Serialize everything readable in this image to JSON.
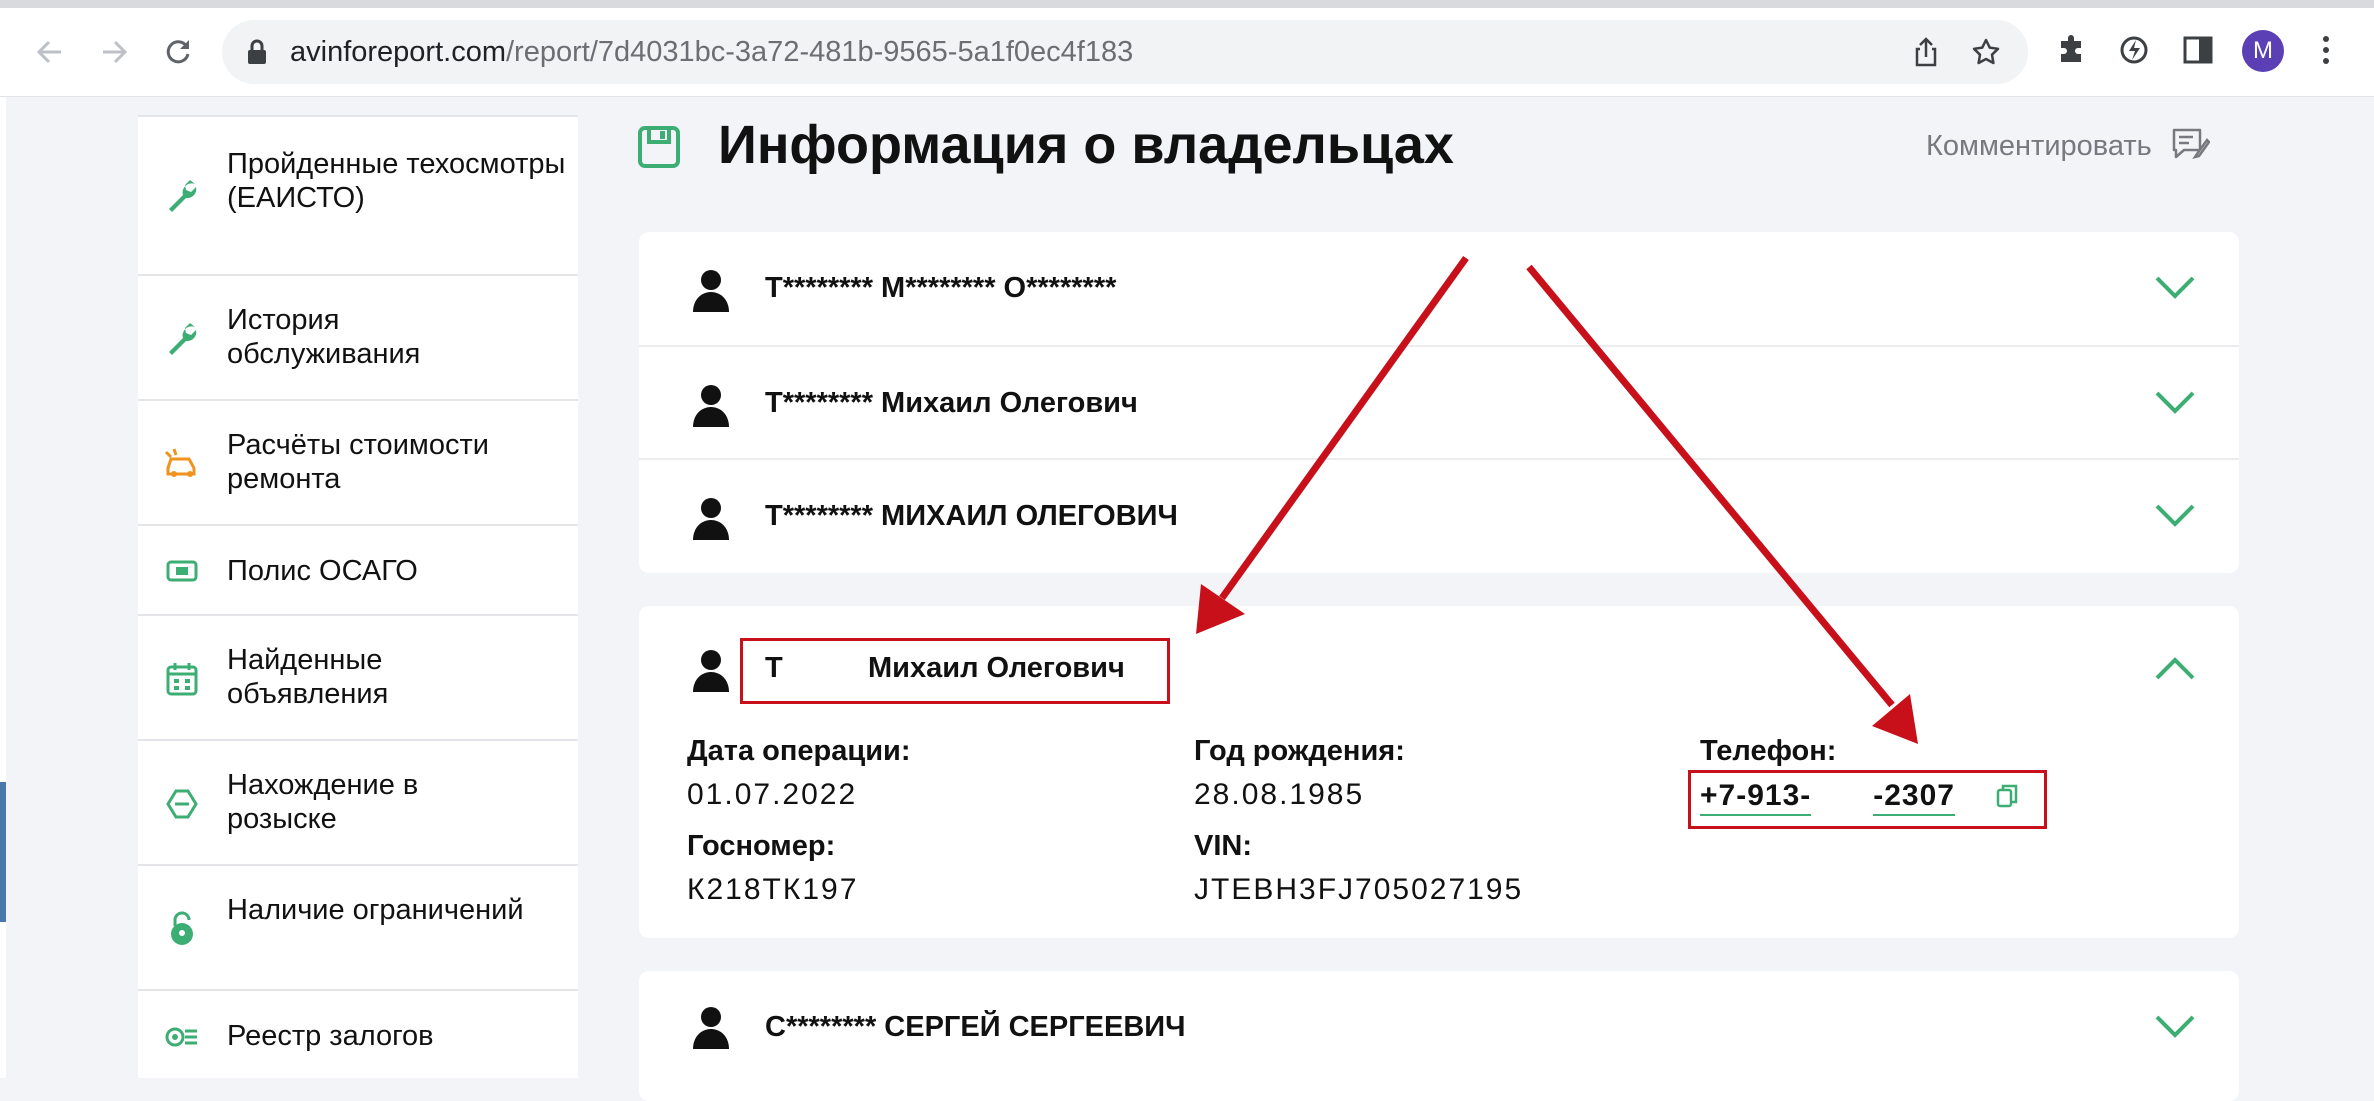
{
  "browser": {
    "url_host": "avinforeport.com",
    "url_path": "/report/7d4031bc-3a72-481b-9565-5a1f0ec4f183",
    "profile_initial": "M",
    "icons": [
      "back-icon",
      "forward-icon",
      "reload-icon",
      "lock-icon",
      "share-icon",
      "star-icon",
      "extensions-icon",
      "performance-icon",
      "side-panel-icon",
      "menu-icon"
    ]
  },
  "sidebar": {
    "items": [
      {
        "label": "Пройденные техосмотры (ЕАИСТО)",
        "icon": "wrench-icon"
      },
      {
        "label": "История обслуживания",
        "icon": "wrench-icon"
      },
      {
        "label": "Расчёты стоимости ремонта",
        "icon": "damaged-car-icon"
      },
      {
        "label": "Полис ОСАГО",
        "icon": "policy-icon"
      },
      {
        "label": "Найденные объявления",
        "icon": "calendar-icon"
      },
      {
        "label": "Нахождение в розыске",
        "icon": "wanted-icon"
      },
      {
        "label": "Наличие ограничений",
        "icon": "padlock-icon"
      },
      {
        "label": "Реестр залогов",
        "icon": "pledge-icon"
      }
    ]
  },
  "section": {
    "title": "Информация о владельцах",
    "comment_label": "Комментировать"
  },
  "owners_group": [
    {
      "name": "Т******** М******** О********"
    },
    {
      "name": "Т******** Михаил Олегович"
    },
    {
      "name": "Т******** МИХАИЛ ОЛЕГОВИЧ"
    }
  ],
  "expanded_owner": {
    "name_initial": "Т",
    "name_rest": "Михаил Олегович",
    "operation_date_label": "Дата операции:",
    "operation_date": "01.07.2022",
    "birth_year_label": "Год рождения:",
    "birth_date": "28.08.1985",
    "phone_label": "Телефон:",
    "phone_start": "+7-913-",
    "phone_end": "-2307",
    "plate_label": "Госномер:",
    "plate": "К218ТК197",
    "vin_label": "VIN:",
    "vin": "JTEBH3FJ705027195"
  },
  "last_owner": {
    "name": "С******** СЕРГЕЙ СЕРГЕЕВИЧ"
  },
  "colors": {
    "accent_green": "#3cae73",
    "annotation_red": "#c8101a",
    "orange_icon": "#f0931e",
    "avatar_purple": "#5b3fb5"
  }
}
